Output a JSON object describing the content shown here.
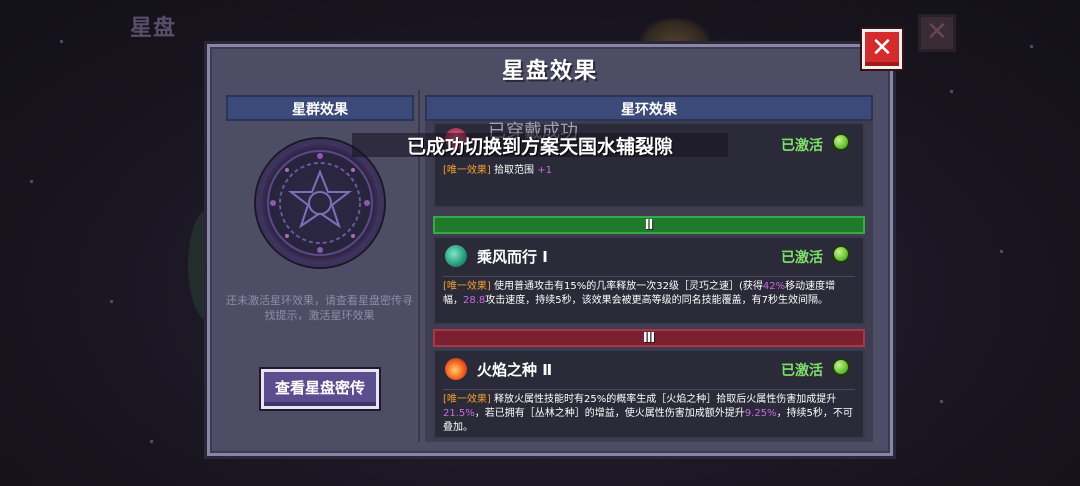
{
  "background": {
    "title": "星盘"
  },
  "dialog": {
    "title": "星盘效果",
    "close_symbol": "✕"
  },
  "left": {
    "header": "星群效果",
    "hint": "还未激活星环效果，请查看星盘密传寻找提示，激活星环效果",
    "button": "查看星盘密传"
  },
  "right": {
    "header": "星环效果",
    "tiers": [
      "Ⅱ",
      "Ⅲ"
    ],
    "cards": [
      {
        "name": "",
        "status": "已激活",
        "desc_tag": "[唯一效果]",
        "desc_text": "拾取范围",
        "desc_hl": "+1"
      },
      {
        "name": "乘风而行 Ⅰ",
        "icon": "wind-swirl-icon",
        "status": "已激活",
        "desc_tag": "[唯一效果]",
        "desc_a": "使用普通攻击有15%的几率释放一次32级［灵巧之速］(获得",
        "desc_hl1": "42%",
        "desc_b": "移动速度增幅，",
        "desc_hl2": "28.8",
        "desc_c": "攻击速度，持续5秒，该效果会被更高等级的同名技能覆盖，有7秒生效间隔。"
      },
      {
        "name": "火焰之种 Ⅱ",
        "icon": "fire-seed-icon",
        "status": "已激活",
        "desc_tag": "[唯一效果]",
        "desc_a": "释放火属性技能时有25%的概率生成［火焰之种］拾取后火属性伤害加成提升",
        "desc_hl1": "21.5%",
        "desc_b": "，若已拥有［丛林之种］的增益，使火属性伤害加成额外提升",
        "desc_hl2": "9.25%",
        "desc_c": "，持续5秒，不可叠加。"
      }
    ]
  },
  "toasts": {
    "faded": "已穿戴成功",
    "main": "已成功切换到方案天国水辅裂隙"
  },
  "colors": {
    "activated": "#7fe06a",
    "tag": "#f0a030",
    "highlight": "#c86ae0",
    "tier2": "#1f7a2c",
    "tier3": "#7a2030"
  }
}
